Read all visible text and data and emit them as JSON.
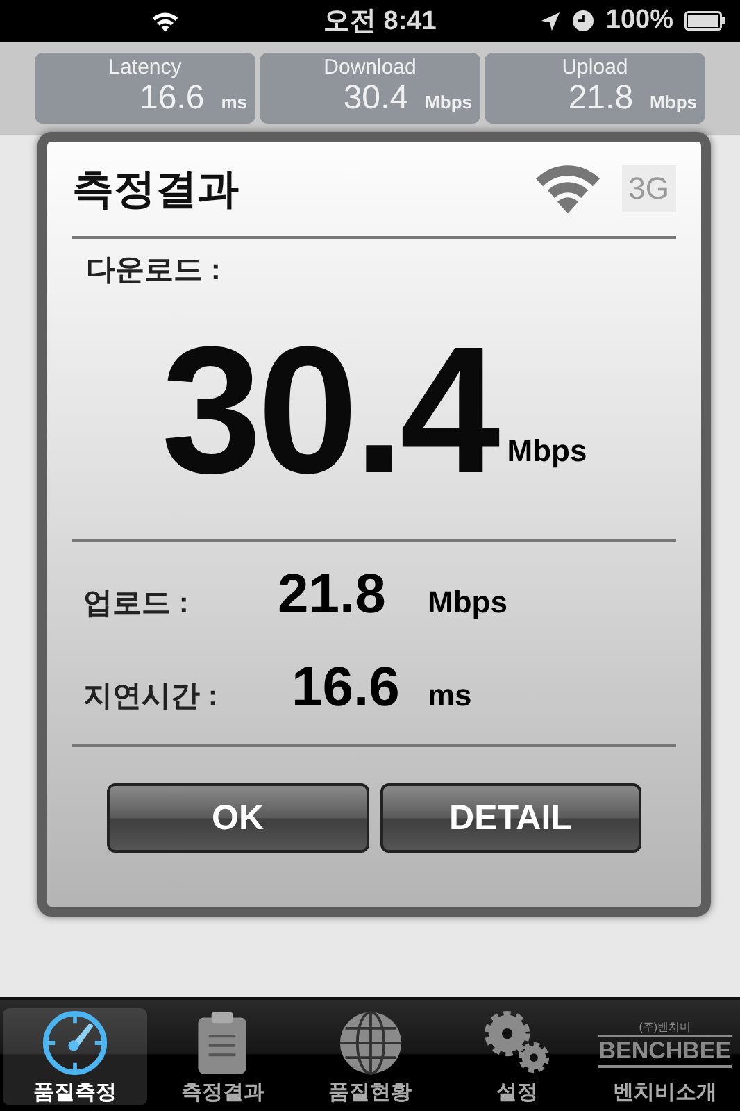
{
  "status_bar": {
    "time": "오전 8:41",
    "battery": "100%"
  },
  "tiles": [
    {
      "label": "Latency",
      "value": "16.6",
      "unit": "ms"
    },
    {
      "label": "Download",
      "value": "30.4",
      "unit": "Mbps"
    },
    {
      "label": "Upload",
      "value": "21.8",
      "unit": "Mbps"
    }
  ],
  "dialog": {
    "title": "측정결과",
    "wifi_active": true,
    "badge": "3G",
    "badge_active": false,
    "download": {
      "label": "다운로드 :",
      "value": "30.4",
      "unit": "Mbps"
    },
    "rows": [
      {
        "label": "업로드 :",
        "value": "21.8",
        "unit": "Mbps"
      },
      {
        "label": "지연시간 :",
        "value": "16.6",
        "unit": "ms"
      }
    ],
    "buttons": [
      "OK",
      "DETAIL"
    ]
  },
  "tab_bar": [
    {
      "kind": "gauge",
      "label": "품질측정",
      "selected": true
    },
    {
      "kind": "clipboard",
      "label": "측정결과",
      "selected": false
    },
    {
      "kind": "globe",
      "label": "품질현황",
      "selected": false
    },
    {
      "kind": "gears",
      "label": "설정",
      "selected": false
    },
    {
      "kind": "logo",
      "label": "벤치비소개",
      "selected": false,
      "logo_small": "(주)벤치비",
      "logo": "BENCHBEE"
    }
  ]
}
